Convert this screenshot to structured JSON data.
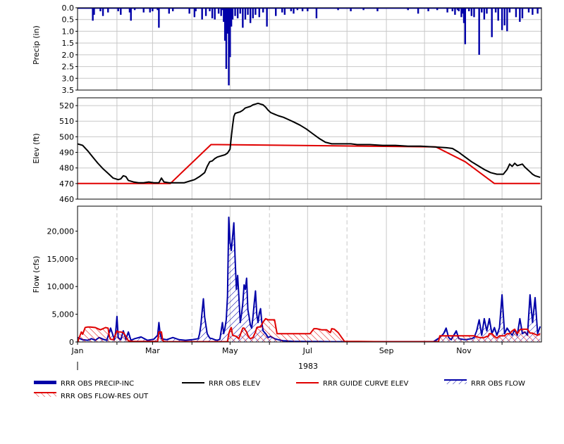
{
  "year_label": "1983",
  "panels": {
    "precip": {
      "ylabel": "Precip (in)",
      "ticks": [
        "0.0",
        "0.5",
        "1.0",
        "1.5",
        "2.0",
        "2.5",
        "3.0",
        "3.5"
      ],
      "ylim": [
        0,
        3.5
      ],
      "reversed": true
    },
    "elev": {
      "ylabel": "Elev (ft)",
      "ticks": [
        "460",
        "470",
        "480",
        "490",
        "500",
        "510",
        "520"
      ],
      "ylim": [
        460,
        525
      ]
    },
    "flow": {
      "ylabel": "Flow (cfs)",
      "ticks": [
        "0",
        "5,000",
        "10,000",
        "15,000",
        "20,000"
      ],
      "ylim": [
        0,
        24500
      ]
    }
  },
  "x_ticks": [
    "Jan",
    "Mar",
    "May",
    "Jul",
    "Sep",
    "Nov"
  ],
  "legend": [
    {
      "label": "RRR OBS PRECIP-INC",
      "color": "#0000a8",
      "style": "thick"
    },
    {
      "label": "RRR OBS ELEV",
      "color": "#000000",
      "style": "line"
    },
    {
      "label": "RRR GUIDE CURVE ELEV",
      "color": "#e00000",
      "style": "line"
    },
    {
      "label": "RRR OBS FLOW",
      "color": "#0000a8",
      "style": "hatch-blue"
    },
    {
      "label": "RRR OBS FLOW-RES OUT",
      "color": "#e00000",
      "style": "hatch-red"
    }
  ],
  "chart_data": [
    {
      "type": "bar",
      "name": "precip",
      "series": [
        {
          "name": "RRR OBS PRECIP-INC",
          "color": "#0000a8",
          "x_day": [
            12,
            13,
            18,
            20,
            24,
            32,
            34,
            41,
            42,
            45,
            52,
            57,
            59,
            63,
            64,
            72,
            75,
            88,
            92,
            93,
            98,
            101,
            104,
            106,
            108,
            111,
            113,
            114,
            115,
            116,
            117,
            118,
            119,
            120,
            121,
            122,
            124,
            126,
            128,
            130,
            132,
            134,
            136,
            138,
            140,
            143,
            146,
            149,
            156,
            161,
            163,
            168,
            170,
            173,
            177,
            181,
            188,
            205,
            215,
            225,
            236,
            260,
            268,
            276,
            283,
            291,
            295,
            297,
            299,
            300,
            302,
            303,
            304,
            305,
            308,
            310,
            312,
            316,
            318,
            320,
            322,
            326,
            329,
            331,
            334,
            336,
            338,
            340,
            345,
            348,
            350,
            355,
            358,
            362
          ],
          "values": [
            0.55,
            0.3,
            0.15,
            0.35,
            0.2,
            0.15,
            0.3,
            0.2,
            0.55,
            0.1,
            0.2,
            0.2,
            0.15,
            0.1,
            0.85,
            0.25,
            0.15,
            0.25,
            0.4,
            0.15,
            0.5,
            0.35,
            0.15,
            0.45,
            0.5,
            0.25,
            0.35,
            0.1,
            0.6,
            1.4,
            2.6,
            1.1,
            3.3,
            2.1,
            0.8,
            0.5,
            0.35,
            0.45,
            0.25,
            0.85,
            0.5,
            0.3,
            0.65,
            0.45,
            0.3,
            0.4,
            0.2,
            0.8,
            0.35,
            0.2,
            0.3,
            0.15,
            0.25,
            0.1,
            0.15,
            0.15,
            0.45,
            0.1,
            0.15,
            0.1,
            0.15,
            0.1,
            0.25,
            0.15,
            0.1,
            0.2,
            0.15,
            0.3,
            0.1,
            0.15,
            0.4,
            0.25,
            0.65,
            1.55,
            0.15,
            0.35,
            0.4,
            2.0,
            0.2,
            0.5,
            0.25,
            1.25,
            0.2,
            0.55,
            0.95,
            0.75,
            1.0,
            0.2,
            0.4,
            0.6,
            0.45,
            0.2,
            0.3,
            0.25
          ]
        }
      ]
    },
    {
      "type": "line",
      "name": "elev",
      "series": [
        {
          "name": "RRR OBS ELEV",
          "color": "#000000",
          "x_day": [
            0,
            4,
            8,
            12,
            16,
            20,
            24,
            28,
            32,
            34,
            36,
            38,
            40,
            44,
            48,
            52,
            56,
            60,
            64,
            66,
            68,
            72,
            76,
            80,
            84,
            88,
            92,
            96,
            100,
            102,
            104,
            106,
            108,
            110,
            112,
            114,
            116,
            118,
            120,
            121,
            122,
            123,
            124,
            126,
            128,
            130,
            132,
            134,
            136,
            138,
            140,
            142,
            144,
            146,
            148,
            150,
            152,
            155,
            158,
            162,
            166,
            170,
            175,
            180,
            185,
            190,
            195,
            200,
            205,
            210,
            215,
            220,
            230,
            240,
            250,
            260,
            270,
            280,
            290,
            295,
            300,
            305,
            310,
            315,
            320,
            325,
            330,
            335,
            338,
            340,
            342,
            344,
            346,
            348,
            350,
            352,
            354,
            356,
            358,
            360,
            362,
            364
          ],
          "values": [
            495.5,
            494.5,
            491,
            487,
            483,
            479.5,
            476.5,
            473.5,
            472.5,
            473,
            475,
            474.5,
            472,
            471,
            470.5,
            470.5,
            471,
            470.5,
            470.5,
            473.5,
            471,
            470.5,
            470.5,
            470.5,
            470.5,
            471.5,
            472.5,
            474.5,
            477,
            481,
            484,
            484.5,
            486,
            487,
            487.5,
            488,
            488.5,
            489.5,
            492,
            500,
            507,
            513,
            515,
            515.5,
            516,
            517,
            518.5,
            519,
            519.5,
            520.5,
            521,
            521.5,
            521,
            520.5,
            519,
            517,
            515.5,
            514.5,
            513.5,
            512.5,
            511,
            509.5,
            507.5,
            505,
            502,
            499,
            496.5,
            495.5,
            495.5,
            495.5,
            495.5,
            495,
            495,
            494.5,
            494.5,
            494,
            494,
            493.5,
            493,
            492.5,
            490,
            487,
            484,
            481.5,
            479,
            477,
            476,
            476,
            479,
            482.5,
            481,
            483,
            481.5,
            482,
            482.5,
            480.5,
            479,
            477.5,
            476,
            475,
            474.5,
            474
          ]
        },
        {
          "name": "RRR GUIDE CURVE ELEV",
          "color": "#e00000",
          "x_day": [
            0,
            73,
            105,
            110,
            282,
            305,
            328,
            364
          ],
          "values": [
            470,
            470,
            495,
            495,
            493.5,
            484,
            470,
            470
          ]
        }
      ]
    },
    {
      "type": "area",
      "name": "flow",
      "series": [
        {
          "name": "RRR OBS FLOW",
          "color": "#0000a8",
          "x_day": [
            0,
            4,
            8,
            11,
            14,
            17,
            20,
            23,
            26,
            29,
            30,
            31,
            32,
            34,
            36,
            38,
            40,
            42,
            45,
            50,
            55,
            60,
            63,
            64,
            65,
            66,
            68,
            70,
            75,
            80,
            85,
            90,
            95,
            96,
            97,
            98,
            99,
            100,
            102,
            104,
            106,
            108,
            110,
            112,
            113,
            114,
            115,
            116,
            117,
            118,
            119,
            120,
            121,
            122,
            123,
            124,
            125,
            126,
            127,
            128,
            129,
            130,
            131,
            132,
            133,
            134,
            135,
            136,
            137,
            138,
            139,
            140,
            141,
            142,
            143,
            144,
            145,
            146,
            148,
            150,
            152,
            155,
            158,
            160,
            162,
            164,
            166,
            170,
            175,
            180,
            190,
            200,
            210,
            220,
            240,
            260,
            280,
            285,
            288,
            290,
            292,
            294,
            296,
            298,
            300,
            305,
            310,
            312,
            314,
            316,
            318,
            320,
            322,
            324,
            326,
            328,
            330,
            332,
            334,
            336,
            338,
            340,
            342,
            344,
            346,
            348,
            350,
            352,
            354,
            356,
            358,
            360,
            362,
            364
          ],
          "values": [
            800,
            400,
            300,
            600,
            300,
            800,
            500,
            300,
            2500,
            400,
            1800,
            4600,
            800,
            400,
            2000,
            500,
            1800,
            300,
            600,
            900,
            300,
            500,
            1200,
            3500,
            1500,
            600,
            500,
            400,
            800,
            400,
            300,
            400,
            600,
            1500,
            3000,
            5500,
            7800,
            4500,
            1500,
            700,
            600,
            400,
            300,
            500,
            2000,
            3500,
            1500,
            2500,
            4000,
            8200,
            22500,
            18000,
            16500,
            19000,
            21500,
            15000,
            9500,
            12000,
            8000,
            3500,
            5000,
            7000,
            10300,
            9500,
            11500,
            5800,
            4500,
            3000,
            2500,
            4500,
            7000,
            9200,
            5000,
            3500,
            5200,
            6000,
            3500,
            2000,
            1500,
            800,
            1000,
            600,
            400,
            300,
            200,
            200,
            150,
            100,
            100,
            80,
            80,
            50,
            50,
            50,
            50,
            50,
            50,
            800,
            1500,
            2500,
            800,
            400,
            1200,
            2000,
            600,
            400,
            600,
            800,
            2000,
            4000,
            1200,
            4200,
            2000,
            4200,
            1500,
            2600,
            1200,
            2600,
            8500,
            1500,
            2500,
            1800,
            1200,
            2200,
            1200,
            4200,
            1500,
            1800,
            1200,
            8500,
            3500,
            8000,
            1500,
            2800,
            4500,
            5000,
            1500,
            700
          ]
        },
        {
          "name": "RRR OBS FLOW-RES OUT",
          "color": "#e00000",
          "x_day": [
            0,
            3,
            4,
            6,
            8,
            10,
            14,
            18,
            22,
            24,
            25,
            26,
            28,
            30,
            31,
            32,
            34,
            36,
            38,
            40,
            44,
            48,
            52,
            56,
            60,
            62,
            63,
            64,
            66,
            67,
            68,
            70,
            75,
            80,
            85,
            90,
            95,
            100,
            102,
            104,
            106,
            108,
            110,
            115,
            118,
            119,
            120,
            121,
            122,
            125,
            126,
            127,
            128,
            130,
            131,
            133,
            134,
            135,
            136,
            138,
            140,
            141,
            142,
            144,
            146,
            148,
            150,
            152,
            155,
            157,
            158,
            159,
            160,
            165,
            170,
            175,
            180,
            182,
            183,
            186,
            188,
            190,
            192,
            194,
            196,
            198,
            199,
            200,
            202,
            205,
            210,
            220,
            240,
            260,
            280,
            284,
            285,
            286,
            290,
            295,
            300,
            302,
            303,
            306,
            310,
            312,
            316,
            320,
            322,
            323,
            324,
            326,
            328,
            330,
            332,
            334,
            336,
            338,
            340,
            342,
            344,
            346,
            348,
            350,
            352,
            354,
            356,
            358,
            360,
            362,
            364
          ],
          "values": [
            0,
            1800,
            1400,
            2600,
            2700,
            2700,
            2600,
            2200,
            2600,
            2500,
            1000,
            500,
            400,
            1400,
            2000,
            1800,
            1800,
            1700,
            1000,
            200,
            100,
            100,
            100,
            100,
            100,
            100,
            100,
            1800,
            1800,
            300,
            100,
            50,
            50,
            50,
            50,
            50,
            50,
            50,
            50,
            50,
            50,
            50,
            50,
            50,
            50,
            1500,
            2200,
            2600,
            1200,
            1000,
            800,
            600,
            1300,
            2500,
            2500,
            1800,
            1200,
            800,
            600,
            800,
            1800,
            2600,
            2700,
            2700,
            3600,
            4200,
            4000,
            4000,
            4000,
            1500,
            1500,
            1500,
            1500,
            1500,
            1500,
            1500,
            1500,
            1500,
            1500,
            2400,
            2400,
            2300,
            2200,
            2200,
            2200,
            1800,
            1700,
            2400,
            2300,
            1700,
            100,
            100,
            50,
            50,
            50,
            50,
            1100,
            1100,
            1100,
            1100,
            1100,
            1100,
            1100,
            1100,
            1100,
            1100,
            800,
            800,
            1000,
            1000,
            1500,
            1500,
            1000,
            700,
            1100,
            1100,
            1100,
            1500,
            1500,
            2000,
            2300,
            1500,
            2200,
            2300,
            2300,
            2300,
            1600,
            1600,
            1400,
            1200,
            1500,
            1300,
            1000,
            1000
          ]
        }
      ]
    }
  ]
}
